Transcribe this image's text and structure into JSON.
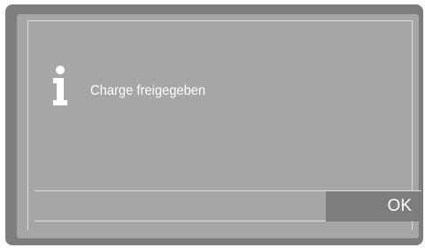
{
  "dialog": {
    "icon": "info-icon",
    "message": "Charge freigegeben",
    "ok_label": "OK"
  },
  "colors": {
    "bezel": "#7d7d80",
    "panel": "#a6a6a8",
    "text": "#ffffff",
    "button": "#7d7d80",
    "lines": "#dcdcdd"
  }
}
